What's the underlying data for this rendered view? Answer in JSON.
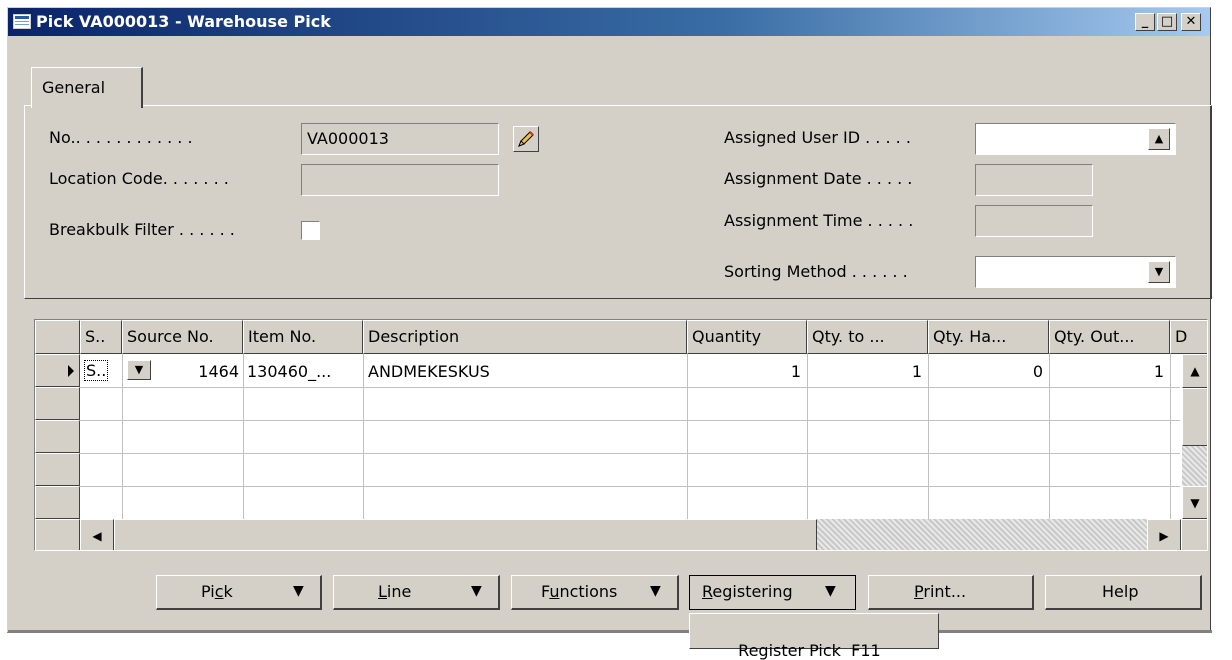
{
  "window": {
    "title": "Pick VA000013 - Warehouse Pick",
    "min_symbol": "_",
    "max_symbol": "□",
    "close_symbol": "✕"
  },
  "tabs": [
    {
      "label": "General"
    }
  ],
  "form": {
    "no_label": "No.. . . . . . . . . . . .",
    "no_value": "VA000013",
    "location_label": "Location Code. . . . . . .",
    "location_value": "",
    "breakbulk_label": "Breakbulk Filter . . . . . .",
    "breakbulk_checked": false,
    "assigned_user_label": "Assigned User ID . . . . .",
    "assigned_user_value": "",
    "assignment_date_label": "Assignment Date . . . . .",
    "assignment_date_value": "",
    "assignment_time_label": "Assignment Time . . . . .",
    "assignment_time_value": "",
    "sorting_label": "Sorting Method . . . . . .",
    "sorting_value": ""
  },
  "table": {
    "columns": [
      "S..",
      "Source No.",
      "Item No.",
      "Description",
      "Quantity",
      "Qty. to ...",
      "Qty. Ha...",
      "Qty. Out...",
      "D"
    ],
    "rows": [
      {
        "s": "S..",
        "source_no": "1464",
        "item_no": "130460_...",
        "description": "ANDMEKESKUS",
        "quantity": "1",
        "qty_to": "1",
        "qty_handled": "0",
        "qty_outstanding": "1"
      }
    ]
  },
  "buttons": {
    "pick_prefix": "Pi",
    "pick_underline": "c",
    "pick_suffix": "k",
    "line_underline": "L",
    "line_suffix": "ine",
    "functions_prefix": "F",
    "functions_underline": "u",
    "functions_suffix": "nctions",
    "registering_underline": "R",
    "registering_suffix": "egistering",
    "print_underline": "P",
    "print_suffix": "rint...",
    "help": "Help"
  },
  "popup_menu": {
    "item": "Register Pick  F11"
  }
}
